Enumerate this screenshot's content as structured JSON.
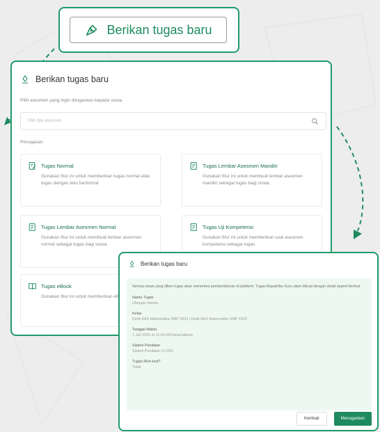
{
  "top_button": {
    "label": "Berikan tugas baru",
    "icon": "pen-nib-icon"
  },
  "panel": {
    "title": "Berikan tugas baru",
    "subtitle": "Pilih asesmen yang ingin ditugaskan kepada siswa",
    "search_placeholder": "Pilih tipe asesmen",
    "section_label": "Penugasan",
    "options": [
      {
        "title": "Tugas Normal",
        "desc": "Gunakan fitur ini untuk memberikan tugas normal atau tugas dengan teks berformat",
        "icon": "edit-doc-icon"
      },
      {
        "title": "Tugas Lembar Asesmen Mandiri",
        "desc": "Gunakan fitur ini untuk membuat lembar asesmen mandiri sebagai tugas bagi siswa.",
        "icon": "list-doc-icon"
      },
      {
        "title": "Tugas Lembar Asesmen Normal",
        "desc": "Gunakan fitur ini untuk membuat lembar asesmen normal sebagai tugas bagi siswa.",
        "icon": "list-doc-icon"
      },
      {
        "title": "Tugas Uji Kompetensi",
        "desc": "Gunakan fitur ini untuk memberikan soal asesmen kompetensi sebagai tugas",
        "icon": "list-doc-icon"
      },
      {
        "title": "Tugas eBook",
        "desc": "Gunakan fitur ini untuk memberikan eBook bagi siswa",
        "icon": "book-icon"
      }
    ]
  },
  "dialog": {
    "title": "Berikan tugas baru",
    "notice": "Semua siswa yang diberi tugas akan menerima pemberitahuan di platform. Tugas Bapak/Ibu Guru akan dibuat dengan detail seperti berikut.",
    "fields": [
      {
        "label": "Nama Tugas",
        "value": "Ulangan Harian"
      },
      {
        "label": "Kelas",
        "value": "Detik AAS Matematika SMP 2023 | Detik AAS Matematika SMP 2023"
      },
      {
        "label": "Tanggal Waktu",
        "value": "1 Juli 2025 at 11:00 AM Asia/Jakarta"
      },
      {
        "label": "Sistem Penilaian",
        "value": "Sistem Penilaian (1-100)"
      },
      {
        "label": "Tugas Rich-text?",
        "value": "Tidak"
      }
    ],
    "back_label": "Kembali",
    "assign_label": "Menugaskan"
  },
  "colors": {
    "accent": "#1e8b5f",
    "border": "#1e9a6a",
    "dialog_body": "#eef8f2"
  }
}
